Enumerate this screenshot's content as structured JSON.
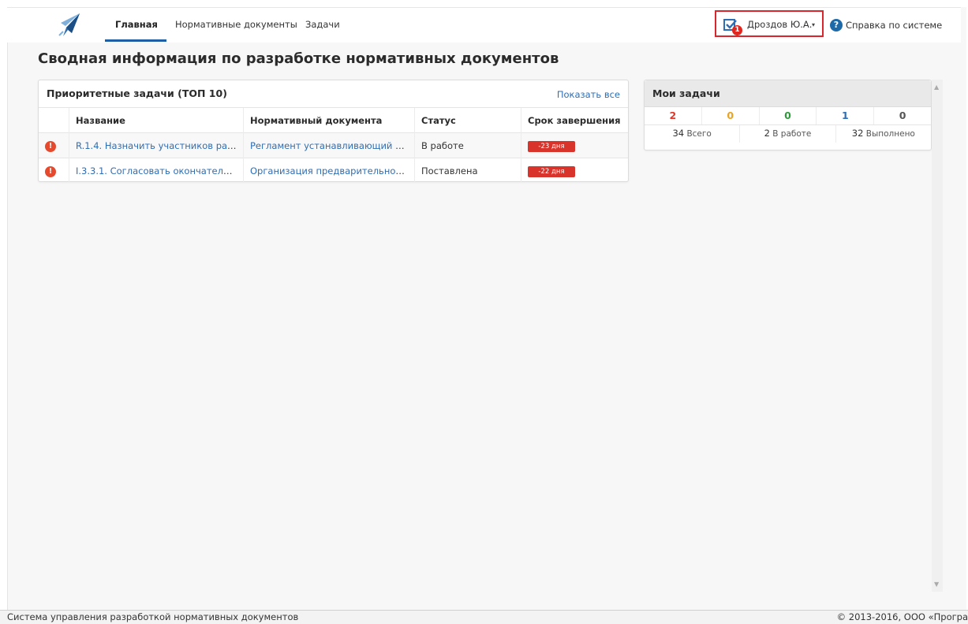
{
  "nav": {
    "items": [
      {
        "label": "Главная",
        "active": true
      },
      {
        "label": "Нормативные документы",
        "active": false
      },
      {
        "label": "Задачи",
        "active": false
      }
    ],
    "user": {
      "name": "Дроздов Ю.А.",
      "notifications": "1",
      "caret": "▾"
    },
    "help": {
      "icon": "?",
      "label": "Справка по системе"
    }
  },
  "page": {
    "title": "Сводная информация по разработке нормативных документов"
  },
  "priority": {
    "title": "Приоритетные задачи (ТОП 10)",
    "show_all": "Показать все",
    "columns": [
      "Название",
      "Нормативный документа",
      "Статус",
      "Срок завершения"
    ],
    "rows": [
      {
        "icon": "!",
        "name": "R.1.4. Назначить участников раз...",
        "document": "Регламент устанавливающий пр...",
        "status": "В работе",
        "due": "-23 дня"
      },
      {
        "icon": "!",
        "name": "I.3.3.1. Согласовать окончательн...",
        "document": "Организация предварительной ...",
        "status": "Поставлена",
        "due": "-22 дня"
      }
    ]
  },
  "my_tasks": {
    "title": "Мои задачи",
    "counts": [
      {
        "value": "2",
        "color": "#e0392b"
      },
      {
        "value": "0",
        "color": "#e8a322"
      },
      {
        "value": "0",
        "color": "#2f9a3a"
      },
      {
        "value": "1",
        "color": "#2e6eb5"
      },
      {
        "value": "0",
        "color": "#555555"
      }
    ],
    "totals": [
      {
        "value": "34",
        "label": "Всего"
      },
      {
        "value": "2",
        "label": "В работе"
      },
      {
        "value": "32",
        "label": "Выполнено"
      }
    ]
  },
  "footer": {
    "left": "Система управления разработкой нормативных документов",
    "right": "© 2013-2016, ООО «Програ"
  },
  "colors": {
    "accent": "#1f5fa6",
    "link": "#2e6eb5",
    "danger": "#d8342b"
  }
}
